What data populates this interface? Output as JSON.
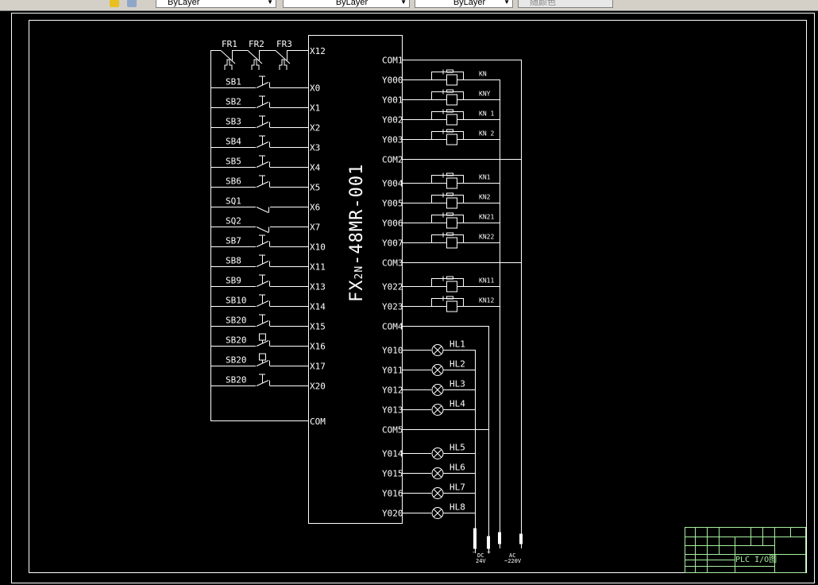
{
  "toolbar": {
    "layer_dropdown": "ByLayer",
    "linetype_dropdown": "ByLayer",
    "lineweight_dropdown": "ByLayer",
    "plotstyle_dropdown": "随颜色"
  },
  "plc": {
    "model_prefix": "FX",
    "model_sub": "2N",
    "model_suffix": "-48MR-001",
    "com_label": "COM"
  },
  "thermal_relays": [
    {
      "label": "FR1"
    },
    {
      "label": "FR2"
    },
    {
      "label": "FR3"
    }
  ],
  "thermal_input": "X12",
  "inputs": [
    {
      "device": "SB1",
      "terminal": "X0",
      "type": "pushbutton"
    },
    {
      "device": "SB2",
      "terminal": "X1",
      "type": "pushbutton"
    },
    {
      "device": "SB3",
      "terminal": "X2",
      "type": "pushbutton"
    },
    {
      "device": "SB4",
      "terminal": "X3",
      "type": "pushbutton"
    },
    {
      "device": "SB5",
      "terminal": "X4",
      "type": "pushbutton"
    },
    {
      "device": "SB6",
      "terminal": "X5",
      "type": "pushbutton"
    },
    {
      "device": "SQ1",
      "terminal": "X6",
      "type": "limit-switch"
    },
    {
      "device": "SQ2",
      "terminal": "X7",
      "type": "limit-switch"
    },
    {
      "device": "SB7",
      "terminal": "X10",
      "type": "pushbutton"
    },
    {
      "device": "SB8",
      "terminal": "X11",
      "type": "pushbutton"
    },
    {
      "device": "SB9",
      "terminal": "X13",
      "type": "pushbutton"
    },
    {
      "device": "SB10",
      "terminal": "X14",
      "type": "pushbutton"
    },
    {
      "device": "SB20",
      "terminal": "X15",
      "type": "pushbutton"
    },
    {
      "device": "SB20",
      "terminal": "X16",
      "type": "emergency-button"
    },
    {
      "device": "SB20",
      "terminal": "X17",
      "type": "emergency-button"
    },
    {
      "device": "SB20",
      "terminal": "X20",
      "type": "pushbutton"
    }
  ],
  "outputs": [
    {
      "terminal": "COM1",
      "kind": "com"
    },
    {
      "terminal": "Y000",
      "kind": "relay",
      "device": "KN"
    },
    {
      "terminal": "Y001",
      "kind": "relay",
      "device": "KNY"
    },
    {
      "terminal": "Y002",
      "kind": "relay",
      "device": "KN 1"
    },
    {
      "terminal": "Y003",
      "kind": "relay",
      "device": "KN 2"
    },
    {
      "terminal": "COM2",
      "kind": "com"
    },
    {
      "terminal": "Y004",
      "kind": "relay",
      "device": "KN1"
    },
    {
      "terminal": "Y005",
      "kind": "relay",
      "device": "KN2"
    },
    {
      "terminal": "Y006",
      "kind": "relay",
      "device": "KN21"
    },
    {
      "terminal": "Y007",
      "kind": "relay",
      "device": "KN22"
    },
    {
      "terminal": "COM3",
      "kind": "com"
    },
    {
      "terminal": "Y022",
      "kind": "relay",
      "device": "KN11"
    },
    {
      "terminal": "Y023",
      "kind": "relay",
      "device": "KN12"
    },
    {
      "terminal": "COM4",
      "kind": "com"
    },
    {
      "terminal": "Y010",
      "kind": "lamp",
      "device": "HL1"
    },
    {
      "terminal": "Y011",
      "kind": "lamp",
      "device": "HL2"
    },
    {
      "terminal": "Y012",
      "kind": "lamp",
      "device": "HL3"
    },
    {
      "terminal": "Y013",
      "kind": "lamp",
      "device": "HL4"
    },
    {
      "terminal": "COM5",
      "kind": "com"
    },
    {
      "terminal": "Y014",
      "kind": "lamp",
      "device": "HL5"
    },
    {
      "terminal": "Y015",
      "kind": "lamp",
      "device": "HL6"
    },
    {
      "terminal": "Y016",
      "kind": "lamp",
      "device": "HL7"
    },
    {
      "terminal": "Y020",
      "kind": "lamp",
      "device": "HL8"
    }
  ],
  "power": {
    "dc_minus": "-",
    "dc_plus": "+",
    "dc_label": "DC",
    "dc_voltage": "24V",
    "ac_label": "AC",
    "ac_voltage": "~220V"
  },
  "title_block": {
    "title": "PLC I/O图"
  },
  "colors": {
    "background": "#000000",
    "lines": "#ffffff",
    "title_block": "#a8f0a0",
    "toolbar": "#d4d0c8"
  }
}
